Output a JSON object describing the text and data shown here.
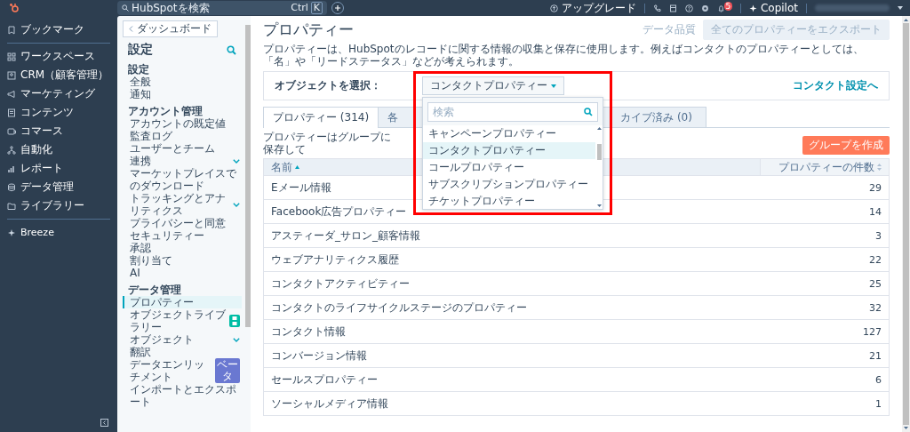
{
  "top_bar": {
    "search": {
      "placeholder": "HubSpotを検索",
      "shortcut_keys": [
        "Ctrl",
        "K"
      ]
    },
    "upgrade": "アップグレード",
    "notification_count": "5",
    "copilot": "Copilot"
  },
  "nav": {
    "bookmark": "ブックマーク",
    "items": [
      "ワークスペース",
      "CRM（顧客管理）",
      "マーケティング",
      "コンテンツ",
      "コマース",
      "自動化",
      "レポート",
      "データ管理",
      "ライブラリー"
    ],
    "breeze": "Breeze"
  },
  "settings": {
    "back_button": "ダッシュボード",
    "title": "設定",
    "sections": [
      {
        "heading": "設定",
        "items": [
          {
            "label": "全般",
            "kind": "link",
            "selected": false
          },
          {
            "label": "通知",
            "kind": "link",
            "selected": false
          }
        ]
      },
      {
        "heading": "アカウント管理",
        "items": [
          {
            "label": "アカウントの既定値",
            "kind": "link",
            "selected": false
          },
          {
            "label": "監査ログ",
            "kind": "link",
            "selected": false
          },
          {
            "label": "ユーザーとチーム",
            "kind": "link",
            "selected": false
          },
          {
            "label": "連携",
            "kind": "group",
            "selected": false
          },
          {
            "label": "マーケットプレイスでのダウンロード",
            "kind": "link",
            "selected": false
          },
          {
            "label": "トラッキングとアナリティクス",
            "kind": "group",
            "selected": false
          },
          {
            "label": "プライバシーと同意",
            "kind": "link",
            "selected": false
          },
          {
            "label": "セキュリティー",
            "kind": "link",
            "selected": false
          },
          {
            "label": "承認",
            "kind": "link",
            "selected": false
          },
          {
            "label": "割り当て",
            "kind": "link",
            "selected": false
          },
          {
            "label": "AI",
            "kind": "link",
            "selected": false
          }
        ]
      },
      {
        "heading": "データ管理",
        "items": [
          {
            "label": "プロパティー",
            "kind": "link",
            "selected": true
          },
          {
            "label": "オブジェクトライブラリー",
            "kind": "link",
            "selected": false,
            "badge": {
              "kind": "icon"
            }
          },
          {
            "label": "オブジェクト",
            "kind": "group",
            "selected": false
          },
          {
            "label": "翻訳",
            "kind": "link",
            "selected": false
          },
          {
            "label": "データエンリッチメント",
            "kind": "link",
            "selected": false,
            "badge": {
              "kind": "text",
              "label": "ベータ"
            }
          },
          {
            "label": "インポートとエクスポート",
            "kind": "link",
            "selected": false
          }
        ]
      }
    ]
  },
  "main": {
    "title": "プロパティー",
    "data_quality": "データ品質",
    "export_button": {
      "label": "全てのプロパティーをエクスポート",
      "disabled": true
    },
    "description": "プロパティーは、HubSpotのレコードに関する情報の収集と保存に使用します。例えばコンタクトのプロパティーとしては、「名」や「リードステータス」などが考えられます。",
    "object_select": {
      "label": "オブジェクトを選択：",
      "value": "コンタクトプロパティー",
      "settings_link": "コンタクト設定へ",
      "dropdown": {
        "search_placeholder": "検索",
        "options": [
          {
            "label": "キャンペーンプロパティー",
            "selected": false
          },
          {
            "label": "コンタクトプロパティー",
            "selected": true
          },
          {
            "label": "コールプロパティー",
            "selected": false
          },
          {
            "label": "サブスクリプションプロパティー",
            "selected": false
          },
          {
            "label": "チケットプロパティー",
            "selected": false
          }
        ]
      }
    },
    "tabs": [
      {
        "label": "プロパティー (314)",
        "selected": true
      },
      {
        "label": "各",
        "selected": false
      },
      {
        "label": "カイブ済み (0)",
        "selected": false
      }
    ],
    "group_note": "プロパティーはグループに保存して",
    "create_group_button": "グループを作成",
    "table": {
      "columns": [
        {
          "label": "名前",
          "sorted": true
        },
        {
          "label": "プロパティーの件数",
          "sorted": false
        }
      ],
      "rows": [
        {
          "name": "Eメール情報",
          "count": "29"
        },
        {
          "name": "Facebook広告プロパティー",
          "count": "14"
        },
        {
          "name": "アスティーダ_サロン_顧客情報",
          "count": "3"
        },
        {
          "name": "ウェブアナリティクス履歴",
          "count": "22"
        },
        {
          "name": "コンタクトアクティビティー",
          "count": "25"
        },
        {
          "name": "コンタクトのライフサイクルステージのプロパティー",
          "count": "32"
        },
        {
          "name": "コンタクト情報",
          "count": "127"
        },
        {
          "name": "コンバージョン情報",
          "count": "21"
        },
        {
          "name": "セールスプロパティー",
          "count": "6"
        },
        {
          "name": "ソーシャルメディア情報",
          "count": "1"
        }
      ]
    }
  }
}
